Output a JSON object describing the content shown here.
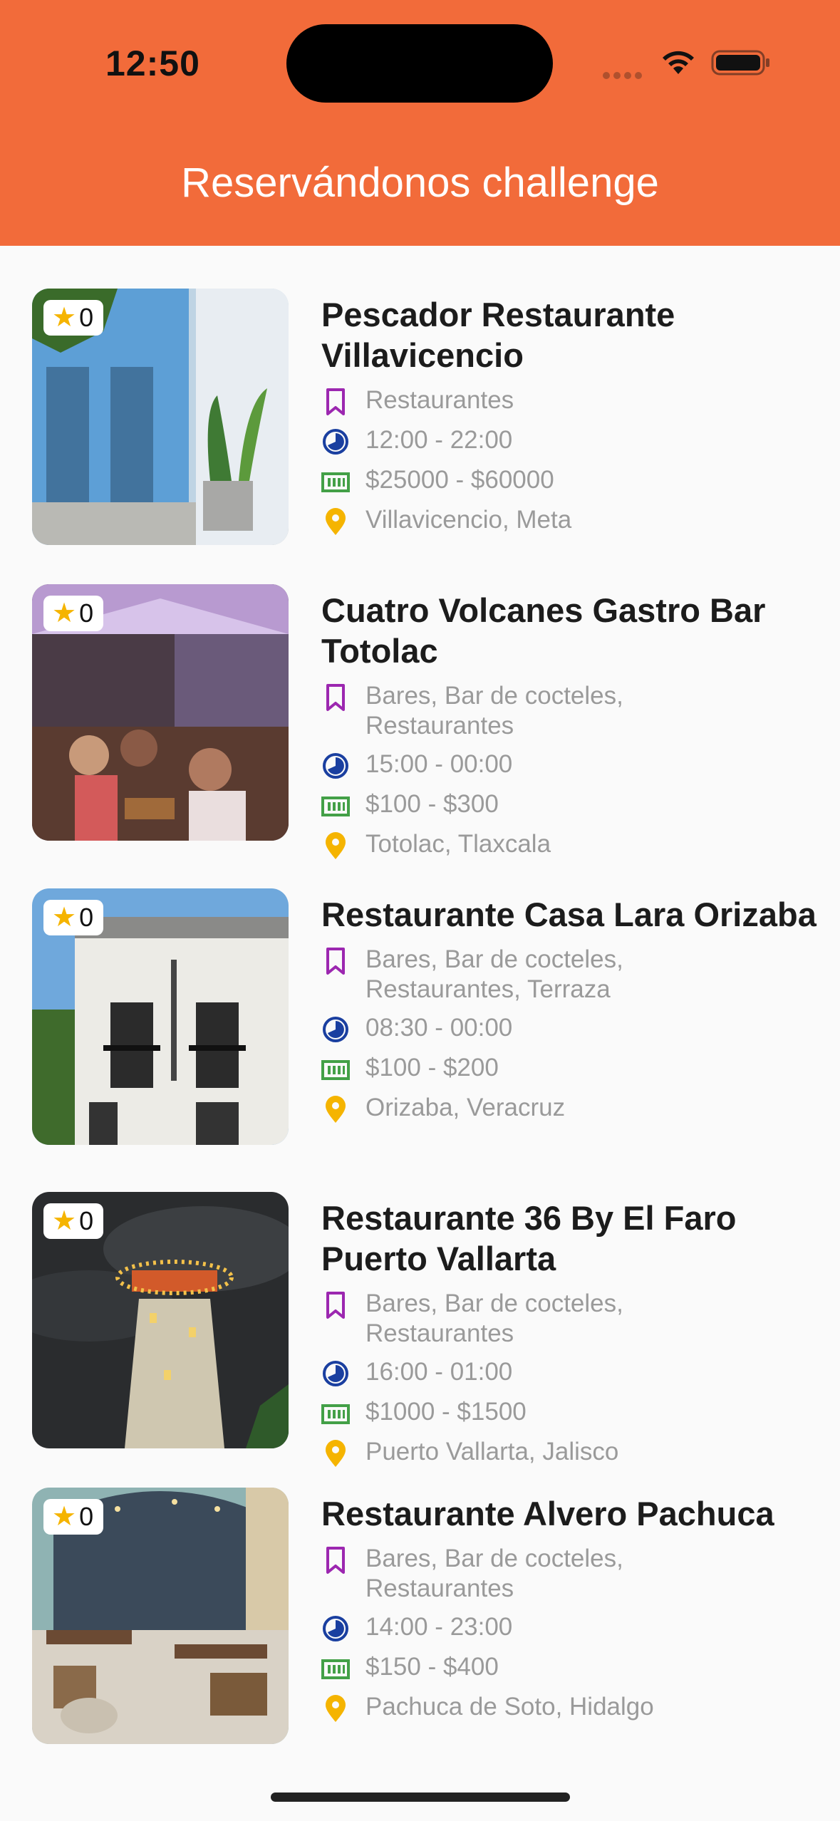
{
  "status_bar": {
    "time": "12:50"
  },
  "app_title": "Reservándonos challenge",
  "colors": {
    "header": "#f26b3a",
    "category_icon": "#9c27b0",
    "clock_icon": "#1a3fa0",
    "price_icon": "#43a047",
    "location_icon": "#f5b400"
  },
  "restaurants": [
    {
      "rating": "0",
      "name": "Pescador Restaurante Villavicencio",
      "categories": "Restaurantes",
      "hours": "12:00 - 22:00",
      "price": "$25000 - $60000",
      "location": "Villavicencio, Meta"
    },
    {
      "rating": "0",
      "name": "Cuatro Volcanes Gastro Bar Totolac",
      "categories": "Bares, Bar de cocteles, Restaurantes",
      "hours": "15:00 - 00:00",
      "price": "$100 - $300",
      "location": "Totolac, Tlaxcala"
    },
    {
      "rating": "0",
      "name": "Restaurante Casa Lara Orizaba",
      "categories": "Bares, Bar de cocteles, Restaurantes, Terraza",
      "hours": "08:30 - 00:00",
      "price": "$100 - $200",
      "location": "Orizaba, Veracruz"
    },
    {
      "rating": "0",
      "name": "Restaurante 36 By El Faro Puerto Vallarta",
      "categories": "Bares, Bar de cocteles, Restaurantes",
      "hours": "16:00 - 01:00",
      "price": "$1000 - $1500",
      "location": "Puerto Vallarta, Jalisco"
    },
    {
      "rating": "0",
      "name": "Restaurante Alvero Pachuca",
      "categories": "Bares, Bar de cocteles, Restaurantes",
      "hours": "14:00 - 23:00",
      "price": "$150 - $400",
      "location": "Pachuca de Soto, Hidalgo"
    }
  ]
}
